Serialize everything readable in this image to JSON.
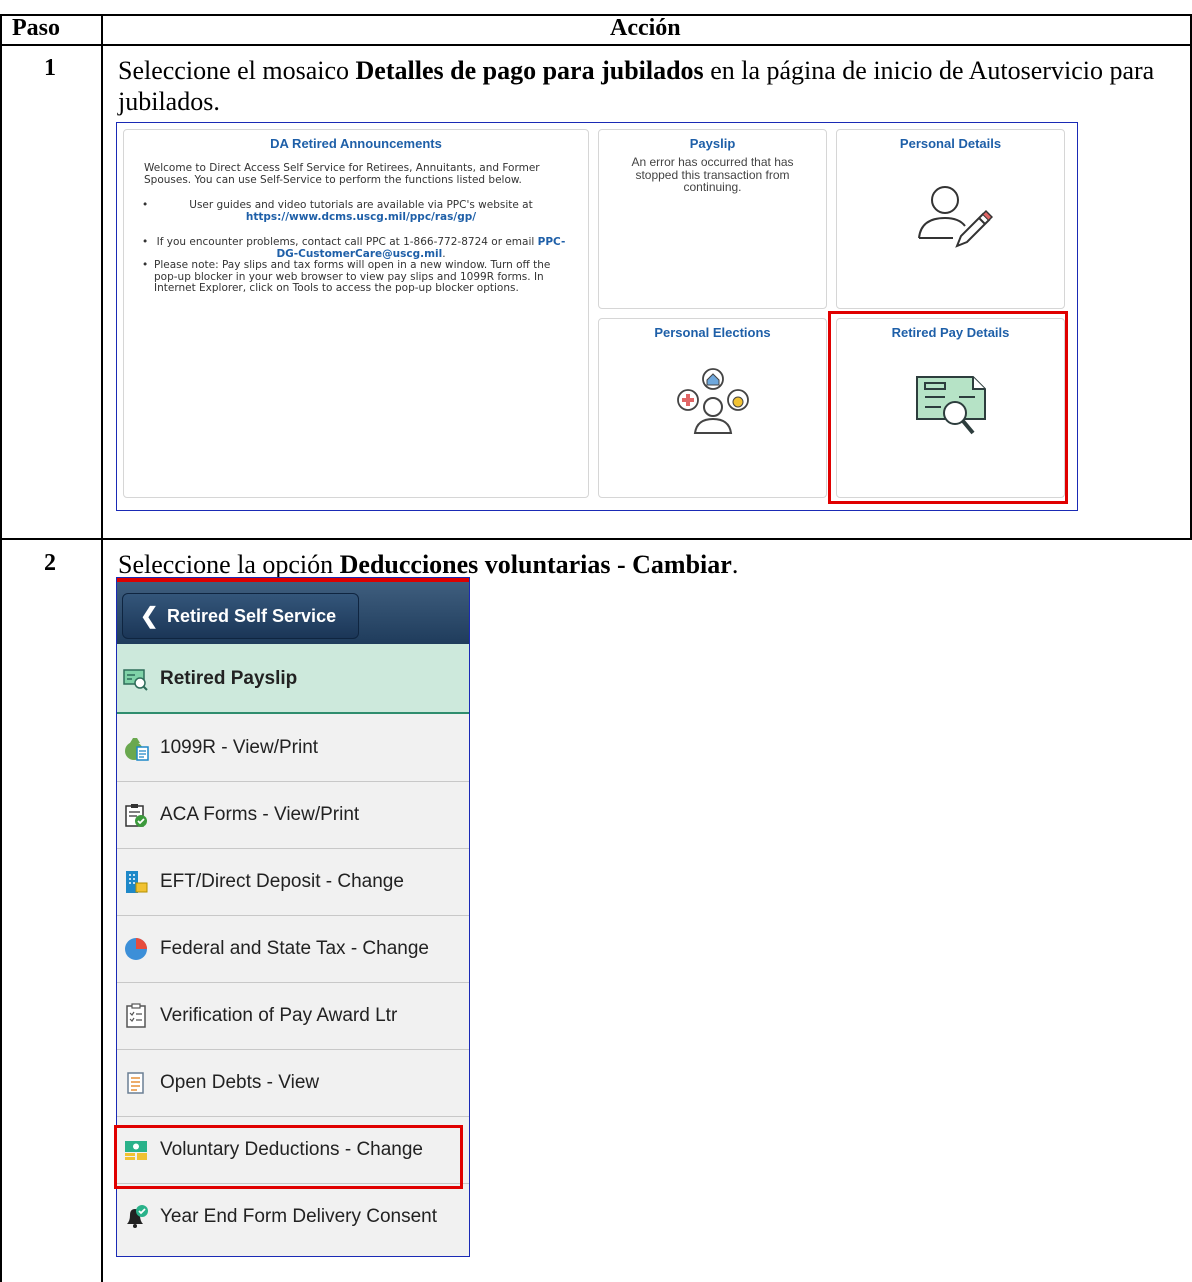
{
  "table": {
    "col_step": "Paso",
    "col_action": "Acción"
  },
  "step1": {
    "number": "1",
    "text_pre": "Seleccione el  mosaico ",
    "text_bold": "Detalles de pago para jubilados",
    "text_post": " en la página de inicio de Autoservicio para jubilados.",
    "screenshot": {
      "announcements": {
        "title": "DA Retired Announcements",
        "intro": "Welcome to Direct Access Self Service for Retirees, Annuitants, and Former Spouses. You can use Self-Service to perform the functions listed below.",
        "b1_text": "User guides and video tutorials are available via PPC's website at ",
        "b1_link": "https://www.dcms.uscg.mil/ppc/ras/gp/",
        "b2_text": "If you encounter problems, contact call PPC at 1-866-772-8724 or email ",
        "b2_link": "PPC-DG-CustomerCare@uscg.mil",
        "b2_end": ".",
        "b3_text": "Please note: Pay slips and tax forms will open in a new window. Turn off the pop-up blocker in your web browser to view pay slips and 1099R forms. In Internet Explorer, click on Tools to access the pop-up blocker options."
      },
      "payslip": {
        "title": "Payslip",
        "error": "An error has occurred that has stopped this transaction from continuing."
      },
      "personal_details": {
        "title": "Personal Details",
        "icon": "person-edit-icon"
      },
      "personal_elections": {
        "title": "Personal Elections",
        "icon": "person-elections-icon"
      },
      "retired_pay_details": {
        "title": "Retired Pay Details",
        "icon": "check-magnifier-icon"
      }
    }
  },
  "step2": {
    "number": "2",
    "text_pre": "Seleccione la  opción ",
    "text_bold": "Deducciones voluntarias - Cambiar",
    "text_post": ".",
    "screenshot": {
      "back_button": "Retired Self Service",
      "items": [
        {
          "label": "Retired Payslip",
          "icon": "payslip-icon",
          "color": "#2f8d6e"
        },
        {
          "label": "1099R - View/Print",
          "icon": "money-bag-icon",
          "color": "#6aa84f"
        },
        {
          "label": "ACA Forms - View/Print",
          "icon": "clipboard-check-icon",
          "color": "#3c9a3c"
        },
        {
          "label": "EFT/Direct Deposit - Change",
          "icon": "bank-icon",
          "color": "#1e88c8"
        },
        {
          "label": "Federal and State Tax - Change",
          "icon": "pie-chart-icon",
          "color": "#e74c3c"
        },
        {
          "label": "Verification of Pay Award Ltr",
          "icon": "checklist-icon",
          "color": "#555555"
        },
        {
          "label": "Open Debts - View",
          "icon": "document-list-icon",
          "color": "#6a7f94"
        },
        {
          "label": "Voluntary Deductions - Change",
          "icon": "money-icon",
          "color": "#2ab28a"
        },
        {
          "label": "Year End Form Delivery Consent",
          "icon": "bell-check-icon",
          "color": "#222222"
        }
      ]
    }
  },
  "colors": {
    "highlight": "#e00000",
    "link": "#1e5fa8",
    "frame": "#1a2ab5"
  }
}
